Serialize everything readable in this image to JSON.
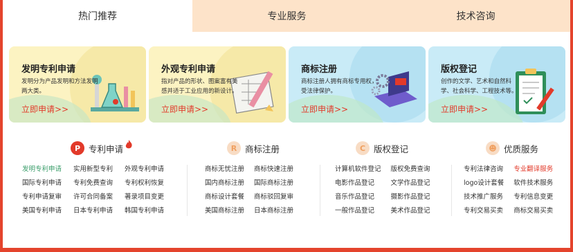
{
  "tabs": [
    {
      "label": "热门推荐",
      "active": true
    },
    {
      "label": "专业服务",
      "active": false
    },
    {
      "label": "技术咨询",
      "active": false
    }
  ],
  "cards": [
    {
      "title": "发明专利申请",
      "desc": "发明分为产品发明和方法发明两大类。",
      "apply": "立即申请>>",
      "theme": "yellow",
      "icon": "lab-flask-icon"
    },
    {
      "title": "外观专利申请",
      "desc": "指对产品的形状、图案富有美感并适于工业应用的新设计。",
      "apply": "立即申请>>",
      "theme": "yellow",
      "icon": "design-blueprint-icon"
    },
    {
      "title": "商标注册",
      "desc": "商标注册人拥有商标专用权，受法律保护。",
      "apply": "立即申请>>",
      "theme": "blue",
      "icon": "laptop-gears-icon"
    },
    {
      "title": "版权登记",
      "desc": "创作的文学、艺术和自然科学、社会科学、工程技术等。",
      "apply": "立即申请>>",
      "theme": "blue",
      "icon": "clipboard-pen-icon"
    }
  ],
  "columns": [
    {
      "title": "专利申请",
      "badge": "P",
      "badge_color": "#e23a2a",
      "has_hot": true,
      "links": [
        "发明专利申请",
        "实用新型专利",
        "外观专利申请",
        "国际专利申请",
        "专利免费查询",
        "专利权利恢复",
        "专利申请复审",
        "许可合同备案",
        "著录项目变更",
        "美国专利申请",
        "日本专利申请",
        "韩国专利申请"
      ]
    },
    {
      "title": "商标注册",
      "badge": "R",
      "badge_color": "#f8dcc4",
      "links": [
        "商标无忧注册",
        "商标快速注册",
        "国内商标注册",
        "国际商标注册",
        "商标设计套餐",
        "商标驳回复审",
        "美国商标注册",
        "日本商标注册"
      ]
    },
    {
      "title": "版权登记",
      "badge": "C",
      "badge_color": "#f8dcc4",
      "links": [
        "计算机软件登记",
        "版权免费查询",
        "电影作品登记",
        "文学作品登记",
        "音乐作品登记",
        "摄影作品登记",
        "一般作品登记",
        "美术作品登记"
      ]
    },
    {
      "title": "优质服务",
      "badge": "☻",
      "badge_color": "#f8dcc4",
      "links": [
        "专利法律咨询",
        "专业翻译服务",
        "logo设计套餐",
        "软件技术服务",
        "技术推广服务",
        "专利信息变更",
        "专利交易买卖",
        "商标交易买卖"
      ]
    }
  ],
  "colors": {
    "accent": "#e23a2a",
    "tab_inactive": "#fde3c9",
    "border": "#e4442d",
    "link_green": "#3a9d6a"
  },
  "highlight": {
    "first_link": "#3a9d6a",
    "translate_link": "#e23a2a"
  }
}
